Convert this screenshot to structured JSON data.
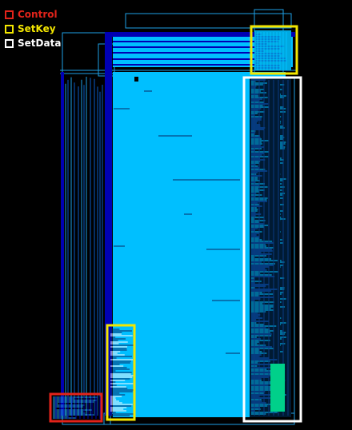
{
  "legend": {
    "items": [
      {
        "label": "Control",
        "color": "#e2231a"
      },
      {
        "label": "SetKey",
        "color": "#f3e600"
      },
      {
        "label": "SetData",
        "color": "#ffffff"
      }
    ]
  },
  "colors": {
    "background": "#000000",
    "core": "#00bfff",
    "route_dark": "#0000b4",
    "route_light": "#1ea0e6",
    "highlight_control": "#e2231a",
    "highlight_setkey": "#f3e600",
    "highlight_setdata": "#ffffff"
  }
}
